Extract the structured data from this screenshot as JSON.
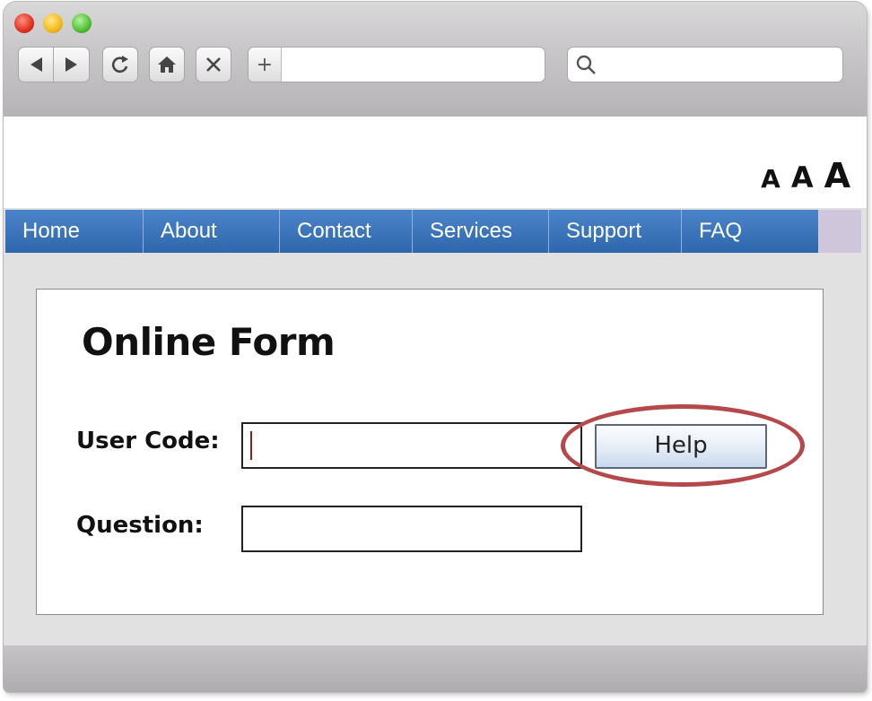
{
  "browser": {
    "icons": {
      "back": "back-arrow-icon",
      "forward": "forward-arrow-icon",
      "reload": "reload-icon",
      "home": "home-icon",
      "stop": "close-icon",
      "new_tab": "plus-icon",
      "search": "search-icon"
    },
    "address_value": "",
    "search_value": ""
  },
  "header": {
    "font_sizes": [
      "A",
      "A",
      "A"
    ]
  },
  "nav": {
    "items": [
      "Home",
      "About",
      "Contact",
      "Services",
      "Support",
      "FAQ"
    ]
  },
  "form": {
    "title": "Online Form",
    "user_code_label": "User Code:",
    "user_code_value": "",
    "question_label": "Question:",
    "question_value": "",
    "help_label": "Help"
  },
  "colors": {
    "nav_bar": "#3a73b8",
    "highlight_ring": "#b5484a",
    "caret": "#8a1f1f"
  }
}
